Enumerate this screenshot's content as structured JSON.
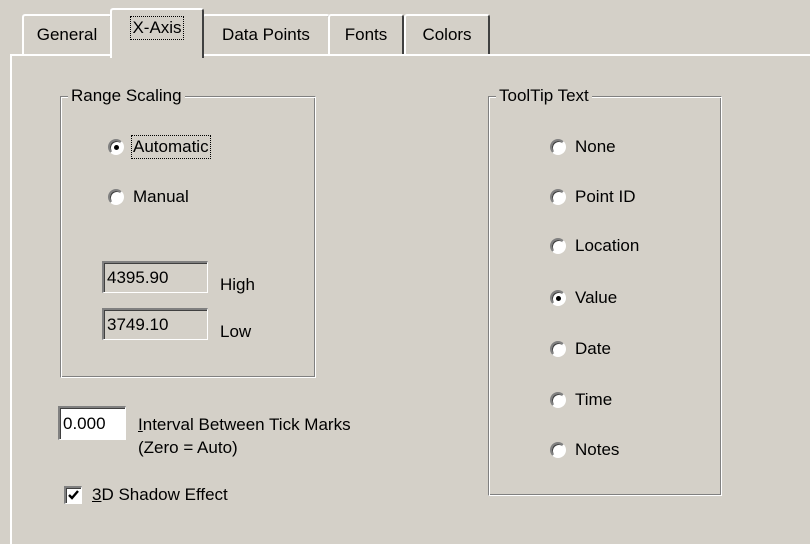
{
  "tabs": [
    {
      "label": "General",
      "active": false
    },
    {
      "label": "X-Axis",
      "active": true
    },
    {
      "label": "Data Points",
      "active": false
    },
    {
      "label": "Fonts",
      "active": false
    },
    {
      "label": "Colors",
      "active": false
    }
  ],
  "range_scaling": {
    "title": "Range Scaling",
    "options": [
      {
        "label": "Automatic",
        "checked": true
      },
      {
        "label": "Manual",
        "checked": false
      }
    ],
    "high": {
      "value": "4395.90",
      "label": "High"
    },
    "low": {
      "value": "3749.10",
      "label": "Low"
    }
  },
  "tick_interval": {
    "value": "0.000",
    "label_first": "I",
    "label_rest": "nterval Between Tick Marks",
    "sublabel": "(Zero = Auto)"
  },
  "shadow": {
    "mnemonic": "3",
    "label_rest": "D Shadow Effect",
    "checked": true
  },
  "tooltip_text": {
    "title": "ToolTip Text",
    "options": [
      {
        "label": "None",
        "checked": false
      },
      {
        "label": "Point ID",
        "checked": false
      },
      {
        "label": "Location",
        "checked": false
      },
      {
        "label": "Value",
        "checked": true
      },
      {
        "label": "Date",
        "checked": false
      },
      {
        "label": "Time",
        "checked": false
      },
      {
        "label": "Notes",
        "checked": false
      }
    ]
  }
}
